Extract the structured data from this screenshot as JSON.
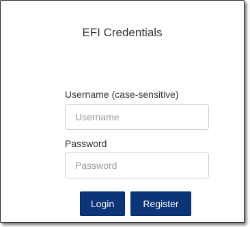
{
  "dialog": {
    "title": "EFI Credentials"
  },
  "form": {
    "username": {
      "label": "Username (case-sensitive)",
      "placeholder": "Username",
      "value": ""
    },
    "password": {
      "label": "Password",
      "placeholder": "Password",
      "value": ""
    },
    "buttons": {
      "login_label": "Login",
      "register_label": "Register"
    }
  },
  "colors": {
    "button_background": "#0c3479",
    "button_text": "#ffffff",
    "text": "#333333"
  }
}
